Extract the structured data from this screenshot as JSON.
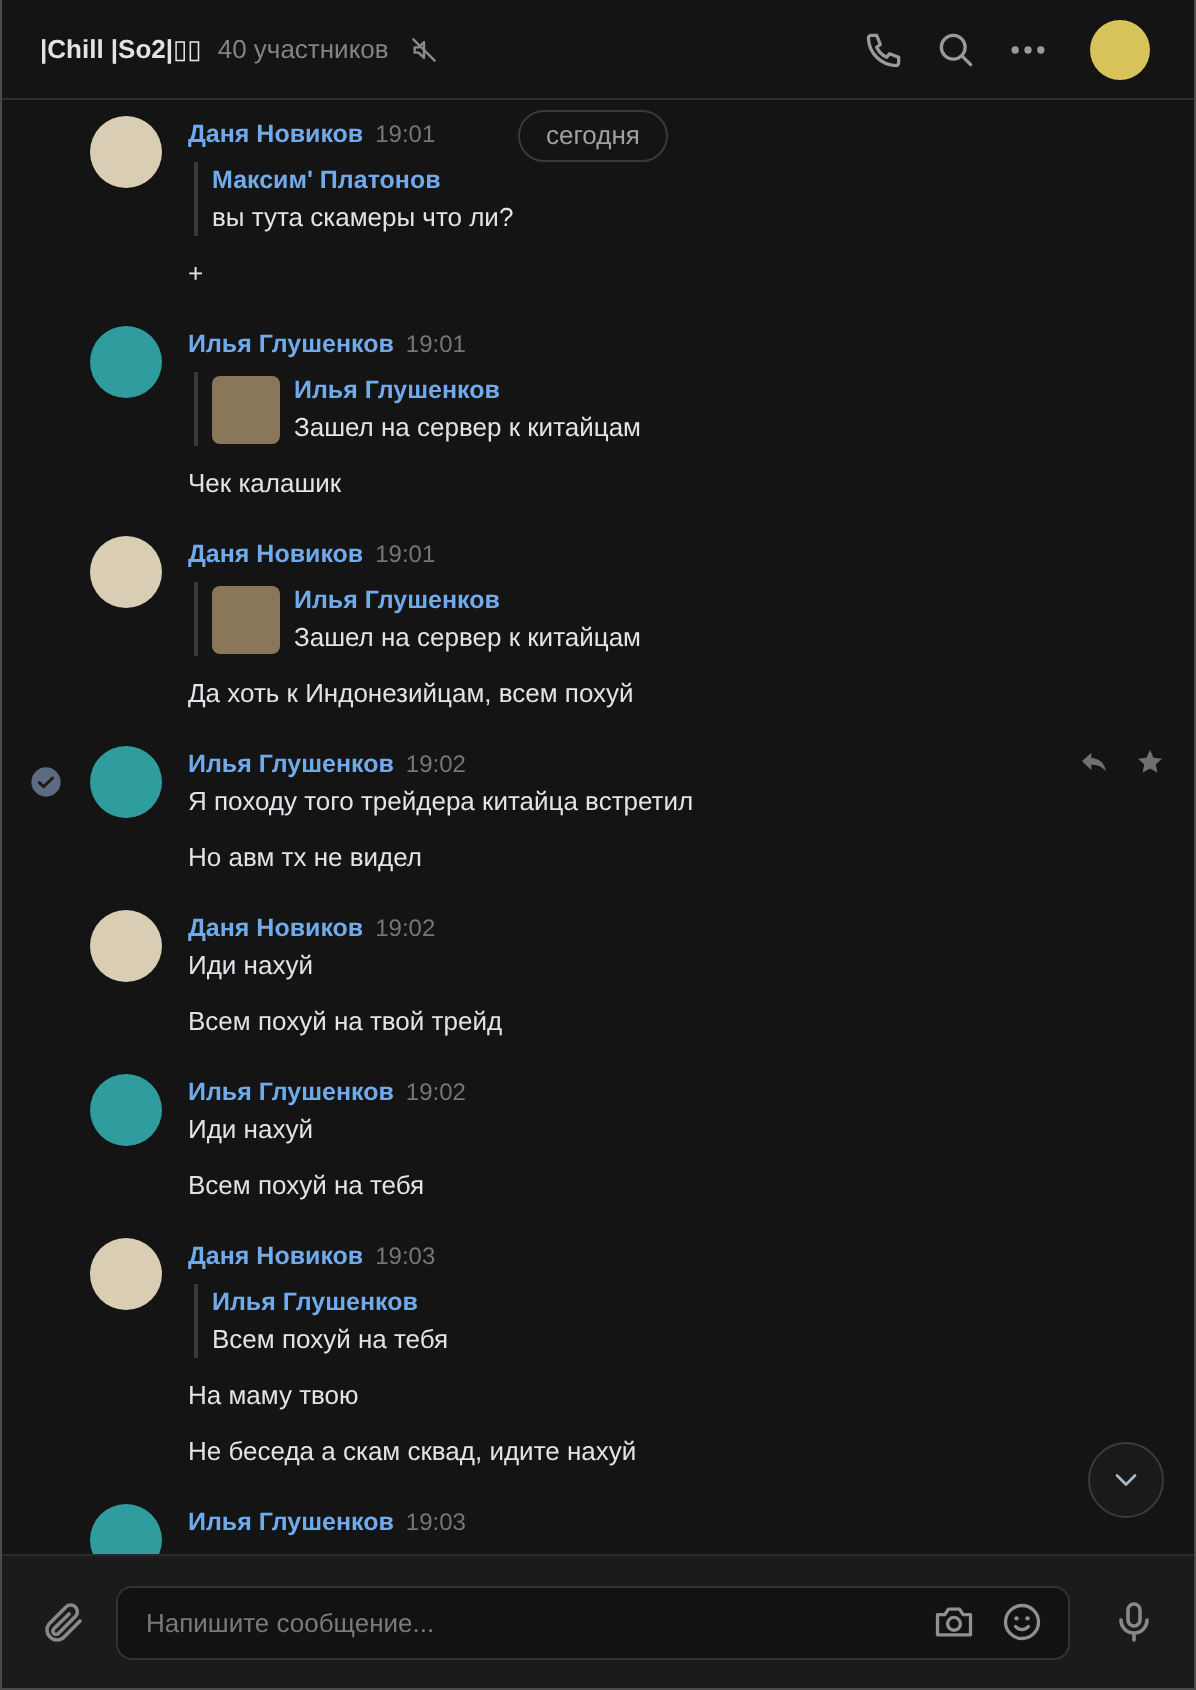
{
  "header": {
    "title": "|Chill |So2|▯▯",
    "members": "40 участников",
    "muted": true
  },
  "date_pill": "сегодня",
  "messages": [
    {
      "author": "Даня Новиков",
      "time": "19:01",
      "color": "#d9cdb4",
      "selected": false,
      "reply": {
        "author": "Максим' Платонов",
        "text": "вы тута скамеры что ли?",
        "thumbnail": false
      },
      "paragraphs": [
        "+"
      ]
    },
    {
      "author": "Илья Глушенков",
      "time": "19:01",
      "color": "#2f9c9e",
      "selected": false,
      "reply": {
        "author": "Илья Глушенков",
        "text": "Зашел на сервер к китайцам",
        "thumbnail": true
      },
      "paragraphs": [
        "Чек калашик"
      ]
    },
    {
      "author": "Даня Новиков",
      "time": "19:01",
      "color": "#d9cdb4",
      "selected": false,
      "reply": {
        "author": "Илья Глушенков",
        "text": "Зашел на сервер к китайцам",
        "thumbnail": true
      },
      "paragraphs": [
        "Да хоть к Индонезийцам, всем похуй"
      ]
    },
    {
      "author": "Илья Глушенков",
      "time": "19:02",
      "color": "#2f9c9e",
      "selected": true,
      "paragraphs": [
        "Я походу того трейдера китайца встретил",
        "Но авм тх не видел"
      ]
    },
    {
      "author": "Даня Новиков",
      "time": "19:02",
      "color": "#d9cdb4",
      "selected": false,
      "paragraphs": [
        "Иди нахуй",
        "Всем похуй на твой трейд"
      ]
    },
    {
      "author": "Илья Глушенков",
      "time": "19:02",
      "color": "#2f9c9e",
      "selected": false,
      "paragraphs": [
        "Иди нахуй",
        "Всем похуй на тебя"
      ]
    },
    {
      "author": "Даня Новиков",
      "time": "19:03",
      "color": "#d9cdb4",
      "selected": false,
      "reply": {
        "author": "Илья Глушенков",
        "text": "Всем похуй на тебя",
        "thumbnail": false
      },
      "paragraphs": [
        "На маму твою",
        "Не беседа а скам сквад, идите нахуй"
      ]
    },
    {
      "author": "Илья Глушенков",
      "time": "19:03",
      "color": "#2f9c9e",
      "selected": false
    }
  ],
  "composer": {
    "placeholder": "Напишите сообщение..."
  }
}
